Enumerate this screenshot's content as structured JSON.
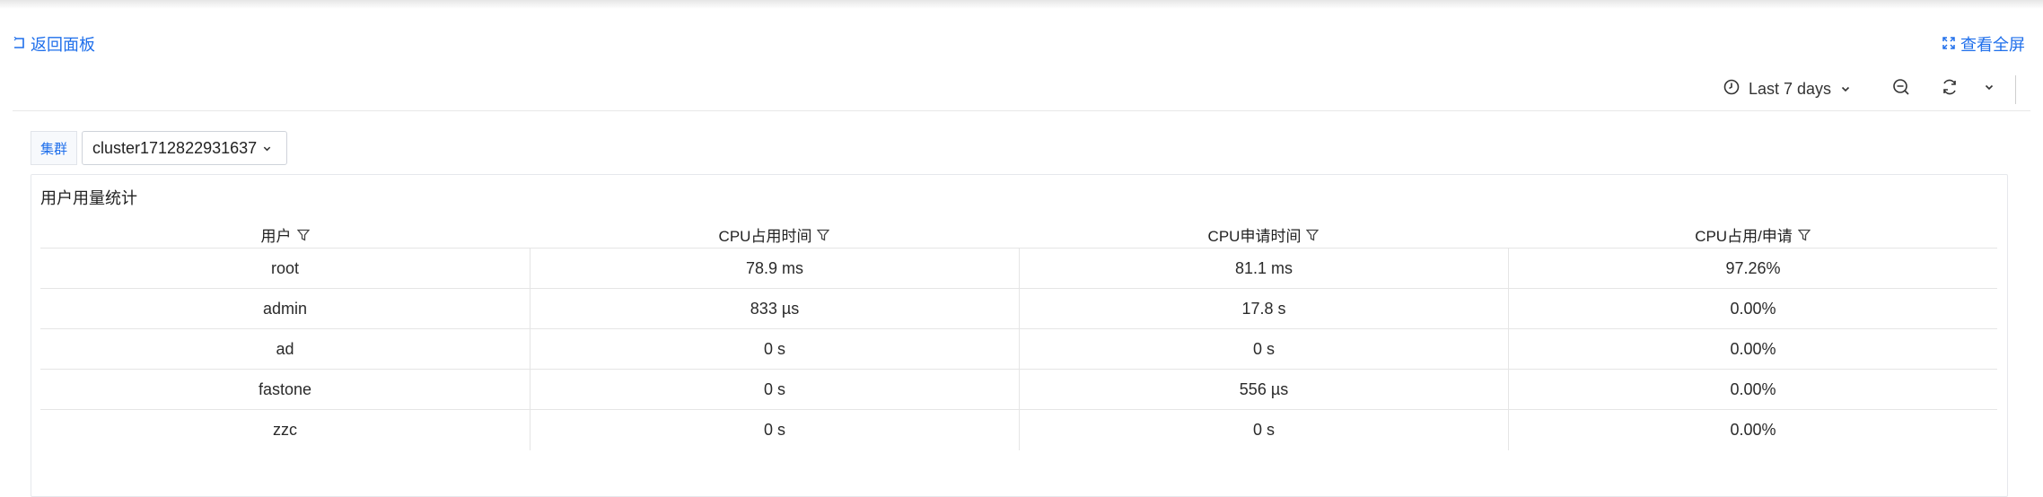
{
  "nav": {
    "back_label": "返回面板",
    "fullscreen_label": "查看全屏"
  },
  "toolbar": {
    "time_range": "Last 7 days",
    "icons": [
      "clock-icon",
      "chevron-down-icon",
      "zoom-out-icon",
      "refresh-icon",
      "chevron-down-icon"
    ]
  },
  "variable": {
    "label": "集群",
    "value": "cluster1712822931637"
  },
  "panel": {
    "title": "用户用量统计",
    "columns": [
      "用户",
      "CPU占用时间",
      "CPU申请时间",
      "CPU占用/申请"
    ],
    "rows": [
      [
        "root",
        "78.9 ms",
        "81.1 ms",
        "97.26%"
      ],
      [
        "admin",
        "833 µs",
        "17.8 s",
        "0.00%"
      ],
      [
        "ad",
        "0 s",
        "0 s",
        "0.00%"
      ],
      [
        "fastone",
        "0 s",
        "556 µs",
        "0.00%"
      ],
      [
        "zzc",
        "0 s",
        "0 s",
        "0.00%"
      ]
    ]
  },
  "colors": {
    "accent": "#1f6feb",
    "border": "#e5e5e5"
  }
}
